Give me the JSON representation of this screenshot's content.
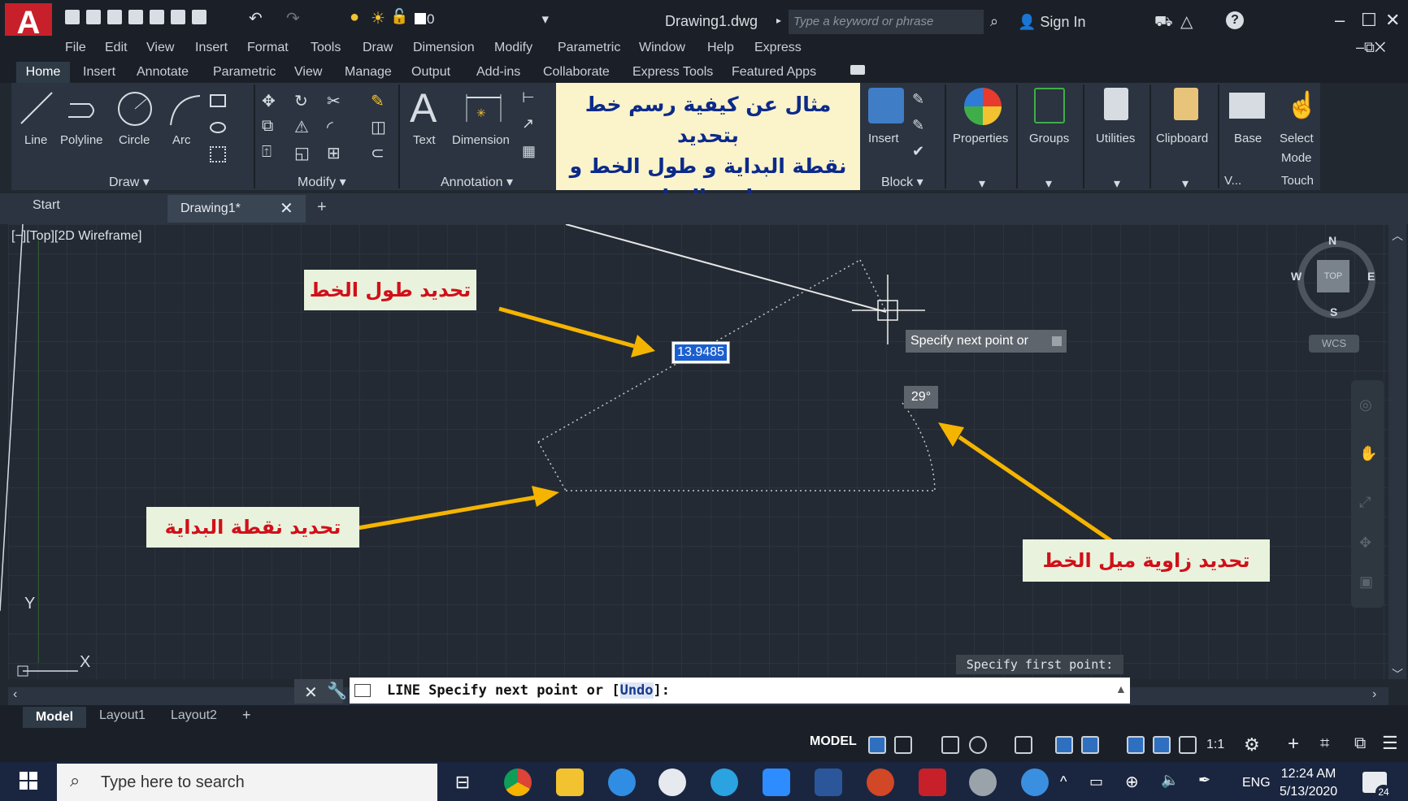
{
  "app": {
    "doc_title": "Drawing1.dwg",
    "search_placeholder": "Type a keyword or phrase",
    "sign_in": "Sign In",
    "layer_value": "0",
    "logo_letter": "A"
  },
  "menu": [
    "File",
    "Edit",
    "View",
    "Insert",
    "Format",
    "Tools",
    "Draw",
    "Dimension",
    "Modify",
    "Parametric",
    "Window",
    "Help",
    "Express"
  ],
  "ribbon_tabs": [
    "Home",
    "Insert",
    "Annotate",
    "Parametric",
    "View",
    "Manage",
    "Output",
    "Add-ins",
    "Collaborate",
    "Express Tools",
    "Featured Apps"
  ],
  "ribbon": {
    "draw_tools": [
      "Line",
      "Polyline",
      "Circle",
      "Arc"
    ],
    "draw_panel": "Draw",
    "modify_panel": "Modify",
    "annotation_tools": [
      "Text",
      "Dimension"
    ],
    "annotation_panel": "Annotation",
    "block_tool": "Insert",
    "block_panel": "Block",
    "big_tools": [
      "Properties",
      "Groups",
      "Utilities",
      "Clipboard",
      "Base"
    ],
    "select_mode": [
      "Select",
      "Mode"
    ],
    "touch": "Touch",
    "view_short": "V..."
  },
  "callout": {
    "line1": "مثال عن كيفية رسم خط بتحديد",
    "line2": "نقطة البداية و طول الخط و",
    "line3": "زاوية الميل"
  },
  "doc_tabs": {
    "start": "Start",
    "drawing": "Drawing1*"
  },
  "viewport": {
    "controls": "[−][Top][2D Wireframe]",
    "dim_length": "13.9485",
    "tooltip": "Specify next point or",
    "angle": "29°",
    "first_point_prompt": "Specify first point:",
    "label_length": "تحديد طول الخط",
    "label_start": "تحديد نقطة البداية",
    "label_angle": "تحديد زاوية ميل الخط",
    "compass": {
      "n": "N",
      "s": "S",
      "e": "E",
      "w": "W",
      "top": "TOP"
    },
    "wcs": "WCS",
    "ucs_x": "X",
    "ucs_y": "Y"
  },
  "command": {
    "prefix": "LINE Specify next point or [",
    "undo": "Undo",
    "suffix": "]:"
  },
  "layout_tabs": {
    "model": "Model",
    "layout1": "Layout1",
    "layout2": "Layout2"
  },
  "status": {
    "model": "MODEL",
    "scale": "1:1"
  },
  "taskbar": {
    "search": "Type here to search",
    "lang": "ENG",
    "time": "12:24 AM",
    "date": "5/13/2020",
    "notif": "24"
  },
  "colors": {
    "accent": "#c8202a",
    "callout_bg": "#fbf3ca",
    "label_bg": "#e9f2dc",
    "label_text": "#d0101a",
    "arrow": "#f5b400"
  }
}
